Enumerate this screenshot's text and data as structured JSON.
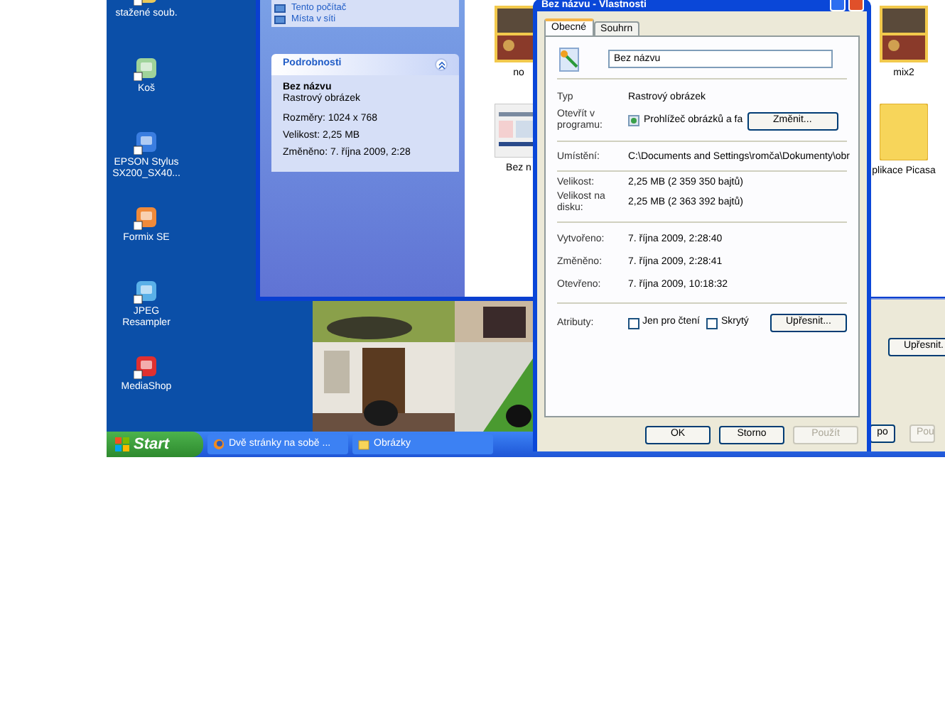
{
  "desktop_icons": [
    {
      "label": "stažené soub."
    },
    {
      "label": "Koš"
    },
    {
      "label": "EPSON Stylus SX200_SX40..."
    },
    {
      "label": "Formix SE"
    },
    {
      "label": "JPEG Resampler"
    },
    {
      "label": "MediaShop"
    }
  ],
  "explorer": {
    "task_links": [
      {
        "label": "Tento počítač"
      },
      {
        "label": "Místa v síti"
      }
    ],
    "details": {
      "title": "Podrobnosti",
      "expanded": true,
      "name": "Bez názvu",
      "type": "Rastrový obrázek",
      "lines": [
        "Rozměry: 1024 x 768",
        "Velikost: 2,25 MB",
        "Změněno: 7. října 2009, 2:28"
      ]
    },
    "thumbnail_rows": [
      [
        {
          "label": "no"
        },
        {
          "label": "mix2"
        }
      ],
      [
        {
          "label": "Bez n",
          "kind": "screenshot"
        },
        {
          "label": "plikace Picasa",
          "kind": "folder"
        }
      ]
    ]
  },
  "background_dialog": {
    "buttons": [
      {
        "label": "Upřesnit.",
        "disabled": false
      },
      {
        "label": "po",
        "disabled": false
      },
      {
        "label": "Pou",
        "disabled": true
      }
    ]
  },
  "properties_dialog": {
    "title": "Bez názvu - Vlastnosti",
    "tabs": [
      {
        "label": "Obecné",
        "selected": true
      },
      {
        "label": "Souhrn",
        "selected": false
      }
    ],
    "name_value": "Bez názvu",
    "type": {
      "label": "Typ",
      "value": "Rastrový obrázek"
    },
    "open_with": {
      "label": "Otevřít v programu:",
      "value": "Prohlížeč obrázků a fa",
      "button": "Změnit..."
    },
    "location": {
      "label": "Umístění:",
      "value": "C:\\Documents and Settings\\romča\\Dokumenty\\obr"
    },
    "sizes": [
      {
        "label": "Velikost:",
        "value": "2,25 MB (2 359 350 bajtů)"
      },
      {
        "label": "Velikost na disku:",
        "value": "2,25 MB (2 363 392 bajtů)"
      }
    ],
    "dates": [
      {
        "label": "Vytvořeno:",
        "value": "7. října 2009, 2:28:40"
      },
      {
        "label": "Změněno:",
        "value": "7. října 2009, 2:28:41"
      },
      {
        "label": "Otevřeno:",
        "value": "7. října 2009, 10:18:32"
      }
    ],
    "attributes": {
      "label": "Atributy:",
      "checkboxes": [
        {
          "label": "Jen pro čtení",
          "checked": false
        },
        {
          "label": "Skrytý",
          "checked": false
        }
      ],
      "button": "Upřesnit..."
    },
    "buttons": [
      {
        "label": "OK",
        "disabled": false
      },
      {
        "label": "Storno",
        "disabled": false
      },
      {
        "label": "Použít",
        "disabled": true
      }
    ]
  },
  "taskbar": {
    "start": "Start",
    "tasks": [
      {
        "label": "Dvě stránky na sobě ...",
        "kind": "browser"
      },
      {
        "label": "Obrázky",
        "kind": "folder"
      }
    ]
  }
}
